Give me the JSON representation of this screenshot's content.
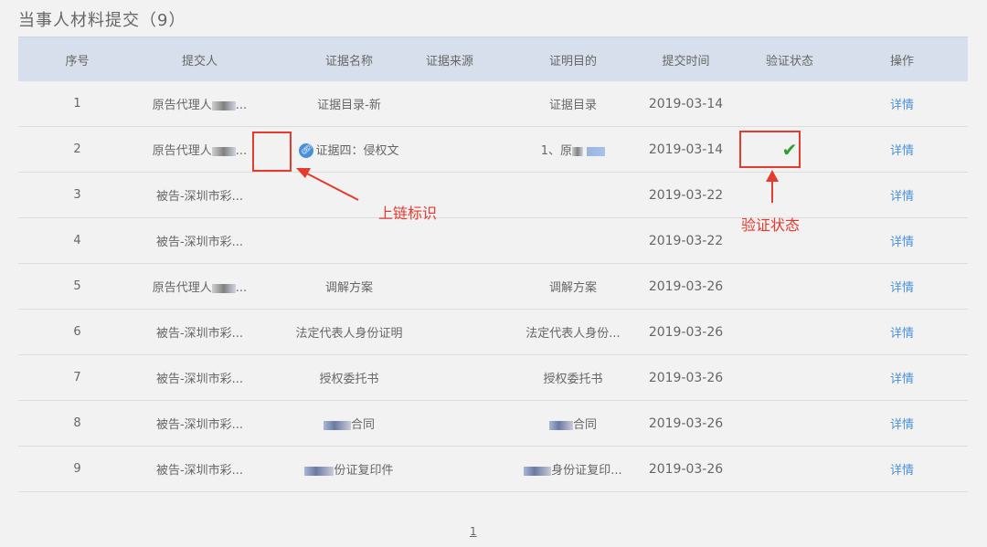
{
  "page": {
    "title": "当事人材料提交（9）"
  },
  "table": {
    "headers": {
      "no": "序号",
      "submitter": "提交人",
      "name": "证据名称",
      "source": "证据来源",
      "purpose": "证明目的",
      "time": "提交时间",
      "verify": "验证状态",
      "action": "操作"
    },
    "rows": [
      {
        "no": "1",
        "submitter_prefix": "原告代理人",
        "submitter_suffix": "...",
        "name": "证据目录-新",
        "purpose": "证据目录",
        "time": "2019-03-14",
        "action": "详情"
      },
      {
        "no": "2",
        "submitter_prefix": "原告代理人",
        "submitter_suffix": "...",
        "name": "证据四：侵权文",
        "purpose_prefix": "1、原",
        "time": "2019-03-14",
        "verify_icon": "check-icon",
        "action": "详情"
      },
      {
        "no": "3",
        "submitter": "被告-深圳市彩...",
        "name": "",
        "purpose": "",
        "time": "2019-03-22",
        "action": "详情"
      },
      {
        "no": "4",
        "submitter": "被告-深圳市彩...",
        "name": "",
        "purpose": "",
        "time": "2019-03-22",
        "action": "详情"
      },
      {
        "no": "5",
        "submitter_prefix": "原告代理人",
        "submitter_suffix": "...",
        "name": "调解方案",
        "purpose": "调解方案",
        "time": "2019-03-26",
        "action": "详情"
      },
      {
        "no": "6",
        "submitter": "被告-深圳市彩...",
        "name": "法定代表人身份证明",
        "purpose": "法定代表人身份...",
        "time": "2019-03-26",
        "action": "详情"
      },
      {
        "no": "7",
        "submitter": "被告-深圳市彩...",
        "name": "授权委托书",
        "purpose": "授权委托书",
        "time": "2019-03-26",
        "action": "详情"
      },
      {
        "no": "8",
        "submitter": "被告-深圳市彩...",
        "name_suffix": "合同",
        "purpose_suffix": "合同",
        "time": "2019-03-26",
        "action": "详情"
      },
      {
        "no": "9",
        "submitter": "被告-深圳市彩...",
        "name_suffix": "份证复印件",
        "purpose_suffix": "身份证复印...",
        "time": "2019-03-26",
        "action": "详情"
      }
    ]
  },
  "annotations": {
    "chain_label": "上链标识",
    "verify_label": "验证状态",
    "color": "#e53a2e"
  },
  "pagination": {
    "current": "1"
  }
}
